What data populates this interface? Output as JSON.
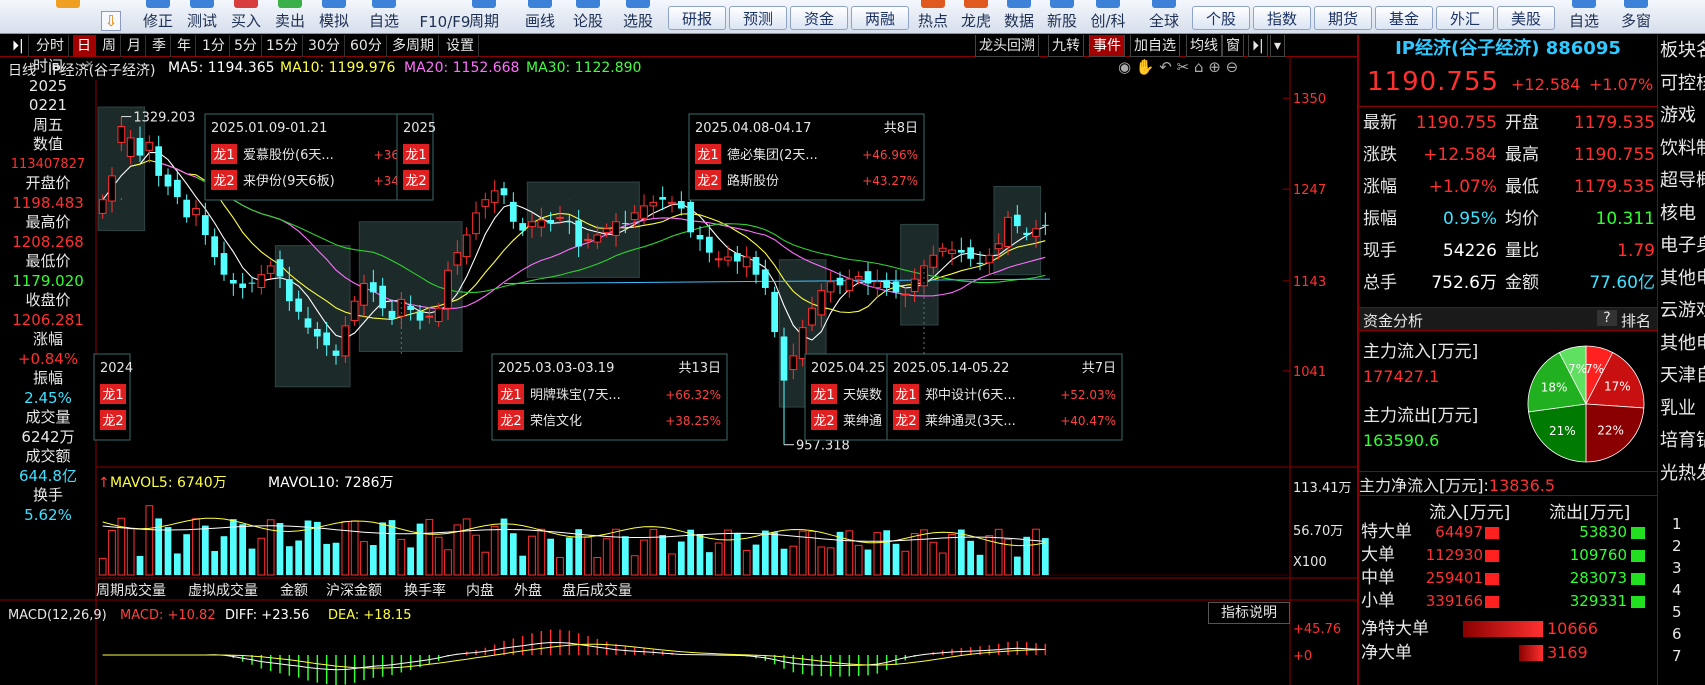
{
  "toolbar": {
    "icon_buttons": [
      "",
      "修正",
      "测试",
      "买入",
      "卖出",
      "模拟",
      "自选",
      "F10/F9",
      "周期",
      "画线",
      "论股",
      "选股"
    ],
    "box_buttons": [
      "研报",
      "预测",
      "资金",
      "两融"
    ],
    "right_buttons": [
      "热点",
      "龙虎",
      "数据",
      "新股",
      "创/科",
      "全球"
    ],
    "market_buttons": [
      "个股",
      "指数",
      "期货",
      "基金",
      "外汇",
      "美股"
    ],
    "far_buttons": [
      "自选",
      "多窗"
    ]
  },
  "period_tabs": [
    "分时",
    "日",
    "周",
    "月",
    "季",
    "年",
    "1分",
    "5分",
    "15分",
    "30分",
    "60分",
    "多周期",
    "设置"
  ],
  "right_tabs": [
    "龙头回溯",
    "九转",
    "事件",
    "加自选",
    "均线",
    "窗"
  ],
  "ma_line": {
    "prefix": "日线",
    "name": "IP经济(谷子经济)",
    "ma5": "MA5: 1194.365",
    "ma10": "MA10: 1199.976",
    "ma20": "MA20: 1152.668",
    "ma30": "MA30: 1122.890"
  },
  "left_panel": {
    "time_label": "时间",
    "year": "2025",
    "date": "0221",
    "weekday": "周五",
    "value_label": "数值",
    "value": "113407827",
    "open_label": "开盘价",
    "open": "1198.483",
    "high_label": "最高价",
    "high": "1208.268",
    "low_label": "最低价",
    "low": "1179.020",
    "close_label": "收盘价",
    "close": "1206.281",
    "change_label": "涨幅",
    "change": "+0.84%",
    "amp_label": "振幅",
    "amp": "2.45%",
    "vol_label": "成交量",
    "vol": "6242万",
    "amt_label": "成交额",
    "amt": "644.8亿",
    "turn_label": "换手",
    "turn": "5.62%"
  },
  "chart_data": {
    "type": "candlestick",
    "y_ticks": [
      "1350",
      "1247",
      "1143",
      "1041"
    ],
    "price_range": [
      940,
      1365
    ],
    "high_marker": "1329.203",
    "low_marker": "957.318",
    "vol_ticks": [
      "113.41万",
      "56.70万",
      "X100"
    ],
    "vol_legend": {
      "mavol5": "MAVOL5: 6740万",
      "mavol10": "MAVOL10: 7286万"
    },
    "macd_legend": {
      "name": "MACD(12,26,9)",
      "macd": "MACD: +10.82",
      "diff": "DIFF: +23.56",
      "dea": "DEA: +18.15"
    },
    "macd_ticks": [
      "+45.76",
      "+0"
    ],
    "closes": [
      1235,
      1262,
      1290,
      1305,
      1285,
      1300,
      1262,
      1250,
      1238,
      1215,
      1225,
      1195,
      1170,
      1150,
      1140,
      1135,
      1140,
      1150,
      1160,
      1148,
      1120,
      1108,
      1090,
      1080,
      1070,
      1058,
      1092,
      1120,
      1140,
      1130,
      1112,
      1100,
      1122,
      1110,
      1098,
      1103,
      1112,
      1155,
      1175,
      1195,
      1220,
      1235,
      1245,
      1240,
      1210,
      1200,
      1210,
      1212,
      1208,
      1215,
      1210,
      1182,
      1190,
      1195,
      1202,
      1210,
      1208,
      1220,
      1228,
      1232,
      1235,
      1232,
      1225,
      1198,
      1190,
      1175,
      1168,
      1170,
      1165,
      1170,
      1150,
      1135,
      1085,
      1035,
      1058,
      1090,
      1112,
      1132,
      1142,
      1138,
      1145,
      1148,
      1140,
      1142,
      1135,
      1130,
      1128,
      1145,
      1160,
      1172,
      1180,
      1178,
      1175,
      1168,
      1162,
      1172,
      1185,
      1215,
      1205,
      1195,
      1202,
      1206
    ],
    "events": [
      {
        "range": "2025.01.09-01.21",
        "items": [
          [
            "龙1",
            "爱慕股份(6天...",
            "+36"
          ],
          [
            "龙2",
            "来伊份(9天6板)",
            "+34"
          ]
        ]
      },
      {
        "range": "2025",
        "items": [
          [
            "龙1",
            "",
            ""
          ],
          [
            "龙2",
            "",
            ""
          ]
        ]
      },
      {
        "range": "2025.04.08-04.17",
        "days": "共8日",
        "items": [
          [
            "龙1",
            "德必集团(2天...",
            "+46.96%"
          ],
          [
            "龙2",
            "路斯股份",
            "+43.27%"
          ]
        ]
      },
      {
        "range": "2024",
        "items": [
          [
            "龙1",
            "",
            ""
          ],
          [
            "龙2",
            "",
            ""
          ]
        ]
      },
      {
        "range": "2025.03.03-03.19",
        "days": "共13日",
        "items": [
          [
            "龙1",
            "明牌珠宝(7天...",
            "+66.32%"
          ],
          [
            "龙2",
            "荣信文化",
            "+38.25%"
          ]
        ]
      },
      {
        "range": "2025.04.25",
        "items": [
          [
            "龙1",
            "天娱数",
            ""
          ],
          [
            "龙2",
            "莱绅通",
            ""
          ]
        ]
      },
      {
        "range": "2025.05.14-05.22",
        "days": "共7日",
        "items": [
          [
            "龙1",
            "郑中设计(6天...",
            "+52.03%"
          ],
          [
            "龙2",
            "莱绅通灵(3天...",
            "+40.47%"
          ]
        ]
      }
    ]
  },
  "bottom_tabs": [
    "周期成交量",
    "虚拟成交量",
    "金额",
    "沪深金额",
    "换手率",
    "内盘",
    "外盘",
    "盘后成交量"
  ],
  "indicator_btn": "指标说明",
  "quote": {
    "title": "IP经济(谷子经济) 886095",
    "price": "1190.755",
    "chg": "+12.584",
    "pct": "+1.07%",
    "rows": [
      [
        "最新",
        "1190.755",
        "开盘",
        "1179.535"
      ],
      [
        "涨跌",
        "+12.584",
        "最高",
        "1190.755"
      ],
      [
        "涨幅",
        "+1.07%",
        "最低",
        "1179.535"
      ],
      [
        "振幅",
        "0.95%",
        "均价",
        "10.311"
      ],
      [
        "现手",
        "54226",
        "量比",
        "1.79"
      ],
      [
        "总手",
        "752.6万",
        "金额",
        "77.60亿"
      ]
    ]
  },
  "capital": {
    "title": "资金分析",
    "q": "?",
    "rank": "排名",
    "in_label": "主力流入[万元]",
    "in_val": "177427.1",
    "out_label": "主力流出[万元]",
    "out_val": "163590.6",
    "net_label": "主力净流入[万元]:",
    "net_val": "13836.5",
    "pie": [
      {
        "label": "7%",
        "value": 7,
        "color": "#ff2020"
      },
      {
        "label": "17%",
        "value": 17,
        "color": "#c81010"
      },
      {
        "label": "22%",
        "value": 22,
        "color": "#8a0000"
      },
      {
        "label": "21%",
        "value": 21,
        "color": "#007a00"
      },
      {
        "label": "18%",
        "value": 18,
        "color": "#20b020"
      },
      {
        "label": "7%",
        "value": 7,
        "color": "#60e060"
      }
    ],
    "flow_head": [
      "流入[万元]",
      "流出[万元]"
    ],
    "flow": [
      [
        "特大单",
        "64497",
        "53830"
      ],
      [
        "大单",
        "112930",
        "109760"
      ],
      [
        "中单",
        "259401",
        "283073"
      ],
      [
        "小单",
        "339166",
        "329331"
      ]
    ],
    "net": [
      [
        "净特大单",
        "10666"
      ],
      [
        "净大单",
        "3169"
      ]
    ]
  },
  "sectors": {
    "title": "板块名",
    "items": [
      "可控核",
      "游戏",
      "饮料制",
      "超导概",
      "核电",
      "电子身",
      "其他电",
      "云游戏",
      "其他电",
      "天津自",
      "乳业",
      "培育钻",
      "光热发"
    ],
    "numbers": [
      "1",
      "2",
      "3",
      "4",
      "5",
      "6",
      "7"
    ]
  }
}
